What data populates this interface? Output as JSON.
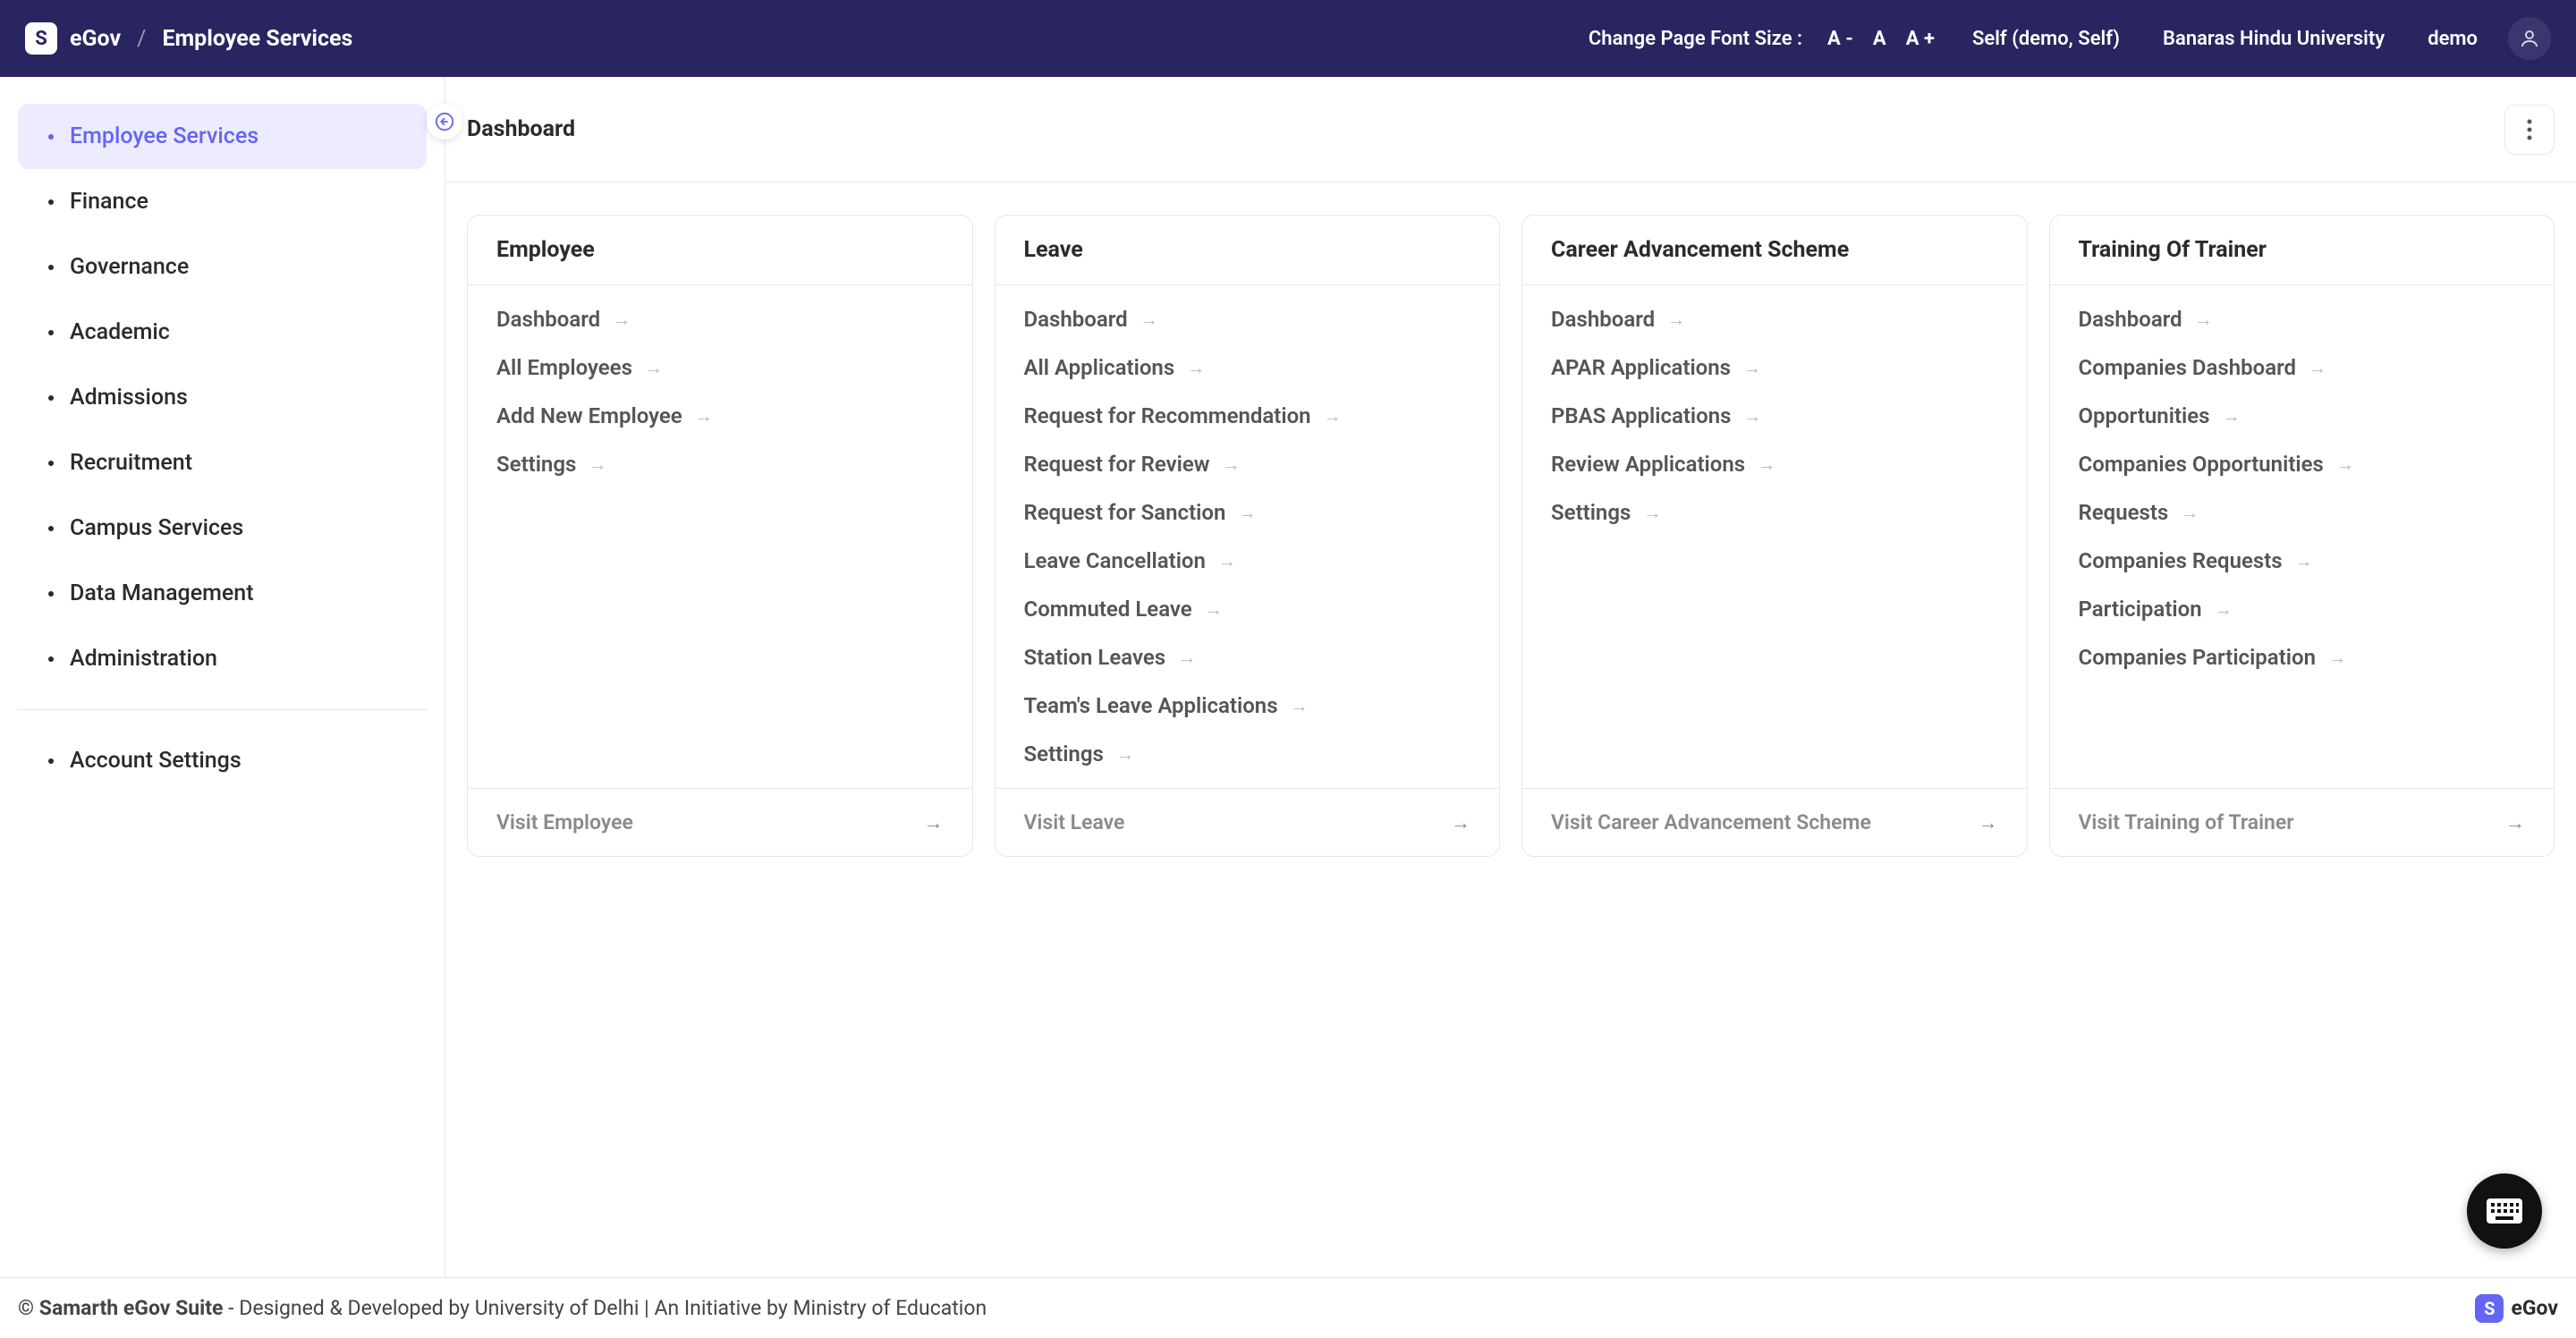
{
  "header": {
    "logo_badge": "S",
    "logo_text": "eGov",
    "breadcrumb_sep": "/",
    "breadcrumb_current": "Employee Services",
    "font_size_label": "Change Page Font Size :",
    "font_decrease": "A -",
    "font_reset": "A",
    "font_increase": "A +",
    "self_link": "Self (demo, Self)",
    "org_link": "Banaras Hindu University",
    "user_name": "demo"
  },
  "sidebar": {
    "items": [
      {
        "label": "Employee Services",
        "active": true
      },
      {
        "label": "Finance"
      },
      {
        "label": "Governance"
      },
      {
        "label": "Academic"
      },
      {
        "label": "Admissions"
      },
      {
        "label": "Recruitment"
      },
      {
        "label": "Campus Services"
      },
      {
        "label": "Data Management"
      },
      {
        "label": "Administration"
      }
    ],
    "secondary": [
      {
        "label": "Account Settings"
      }
    ]
  },
  "page": {
    "title": "Dashboard"
  },
  "cards": [
    {
      "title": "Employee",
      "links": [
        "Dashboard",
        "All Employees",
        "Add New Employee",
        "Settings"
      ],
      "visit": "Visit Employee"
    },
    {
      "title": "Leave",
      "links": [
        "Dashboard",
        "All Applications",
        "Request for Recommendation",
        "Request for Review",
        "Request for Sanction",
        "Leave Cancellation",
        "Commuted Leave",
        "Station Leaves",
        "Team's Leave Applications",
        "Settings"
      ],
      "visit": "Visit Leave"
    },
    {
      "title": "Career Advancement Scheme",
      "links": [
        "Dashboard",
        "APAR Applications",
        "PBAS Applications",
        "Review Applications",
        "Settings"
      ],
      "visit": "Visit Career Advancement Scheme"
    },
    {
      "title": "Training Of Trainer",
      "links": [
        "Dashboard",
        "Companies Dashboard",
        "Opportunities",
        "Companies Opportunities",
        "Requests",
        "Companies Requests",
        "Participation",
        "Companies Participation"
      ],
      "visit": "Visit Training of Trainer"
    }
  ],
  "footer": {
    "copyright_bold": "© Samarth eGov Suite",
    "copyright_rest": " - Designed & Developed by University of Delhi | An Initiative by Ministry of Education",
    "brand_badge": "S",
    "brand_text": "eGov"
  }
}
